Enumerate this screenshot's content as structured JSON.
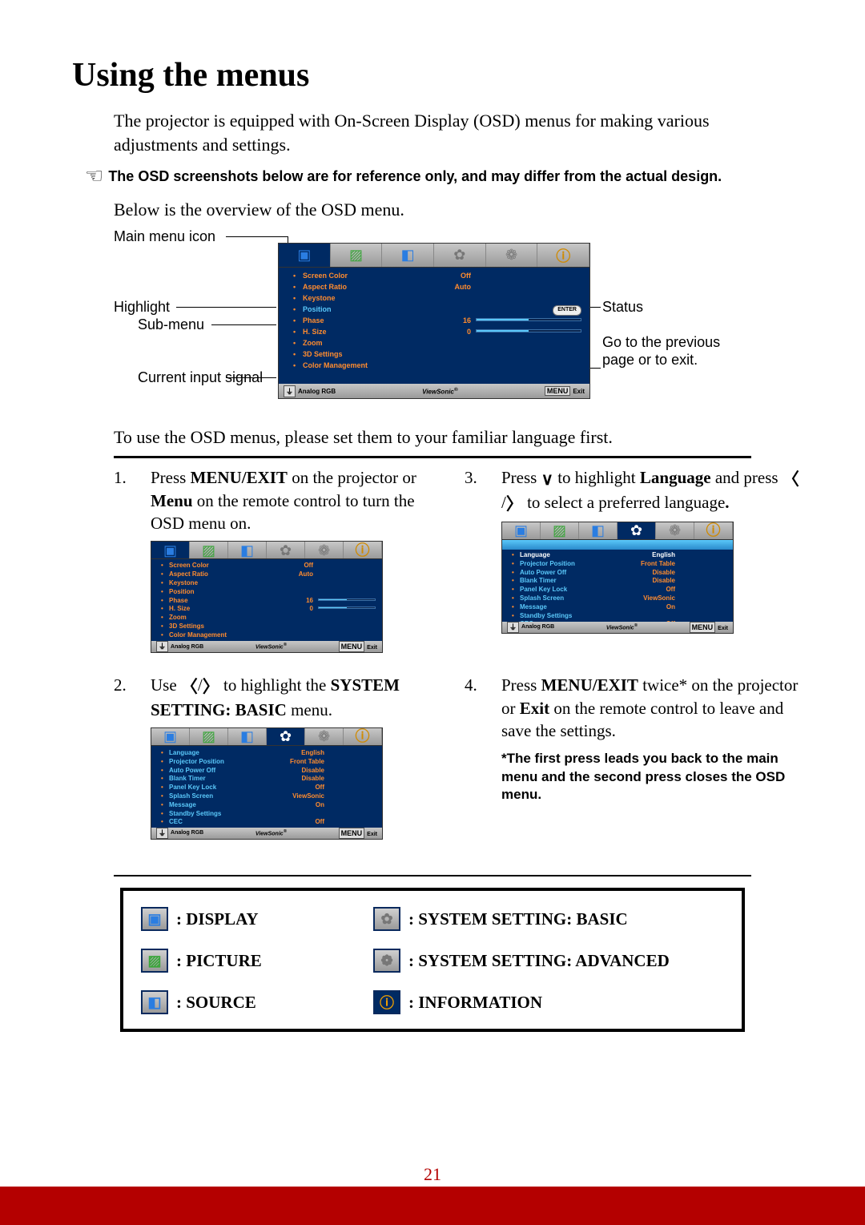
{
  "page_number": "21",
  "heading": "Using the menus",
  "intro": "The projector is equipped with On-Screen Display (OSD) menus for making various adjustments and settings.",
  "note": "The OSD screenshots below are for reference only, and may differ from the actual design.",
  "overview_line": "Below is the overview of the OSD menu.",
  "diagram_labels": {
    "main_menu_icon": "Main menu icon",
    "highlight": "Highlight",
    "submenu": "Sub-menu",
    "current_input": "Current input signal",
    "status": "Status",
    "goto": "Go to the previous page or to exit."
  },
  "below": "To use the OSD menus, please set them to your familiar language first.",
  "osd": {
    "tabs": [
      "display",
      "picture",
      "source",
      "sys1",
      "sys2",
      "info"
    ],
    "display_menu": [
      {
        "label": "Screen Color",
        "val": "Off"
      },
      {
        "label": "Aspect Ratio",
        "val": "Auto"
      },
      {
        "label": "Keystone",
        "val": ""
      },
      {
        "label": "Position",
        "val": "",
        "hl": true,
        "pill": "ENTER"
      },
      {
        "label": "Phase",
        "val": "16",
        "bar": true
      },
      {
        "label": "H. Size",
        "val": "0",
        "bar": true
      },
      {
        "label": "Zoom",
        "val": ""
      },
      {
        "label": "3D Settings",
        "val": ""
      },
      {
        "label": "Color Management",
        "val": ""
      }
    ],
    "sys_menu": [
      {
        "label": "Language",
        "val": "English",
        "hl": true
      },
      {
        "label": "Projector Position",
        "val": "Front Table"
      },
      {
        "label": "Auto Power Off",
        "val": "Disable"
      },
      {
        "label": "Blank Timer",
        "val": "Disable"
      },
      {
        "label": "Panel Key Lock",
        "val": "Off"
      },
      {
        "label": "Splash Screen",
        "val": "ViewSonic"
      },
      {
        "label": "Message",
        "val": "On"
      },
      {
        "label": "Standby Settings",
        "val": ""
      },
      {
        "label": "CEC",
        "val": "Off"
      }
    ],
    "footer_left": "Analog RGB",
    "footer_center": "ViewSonic",
    "footer_menu": "MENU",
    "footer_exit": "Exit"
  },
  "steps": {
    "s1_pre": "Press ",
    "s1_b1": "MENU/EXIT",
    "s1_mid": " on the projector or ",
    "s1_b2": "Menu",
    "s1_post": " on the remote control to turn the OSD menu on.",
    "s2_pre": "Use ",
    "s2_mid": " to highlight the ",
    "s2_b": "SYSTEM SETTING: BASIC",
    "s2_post": " menu.",
    "s3_pre": "Press ",
    "s3_mid": " to highlight ",
    "s3_b": "Language",
    "s3_mid2": " and press ",
    "s3_post": " to select a preferred language",
    "s3_period": ".",
    "s4_pre": "Press ",
    "s4_b1": "MENU/EXIT",
    "s4_mid": " twice* on the projector or ",
    "s4_b2": "Exit",
    "s4_post": " on the remote control to leave and save the settings.",
    "s4_note": "*The first press leads you back to the main menu and the second press closes the OSD menu."
  },
  "legend": {
    "display": ": DISPLAY",
    "picture": ": PICTURE",
    "source": ": SOURCE",
    "sys_basic": ": SYSTEM SETTING: BASIC",
    "sys_adv": ": SYSTEM SETTING: ADVANCED",
    "info": ": INFORMATION"
  }
}
